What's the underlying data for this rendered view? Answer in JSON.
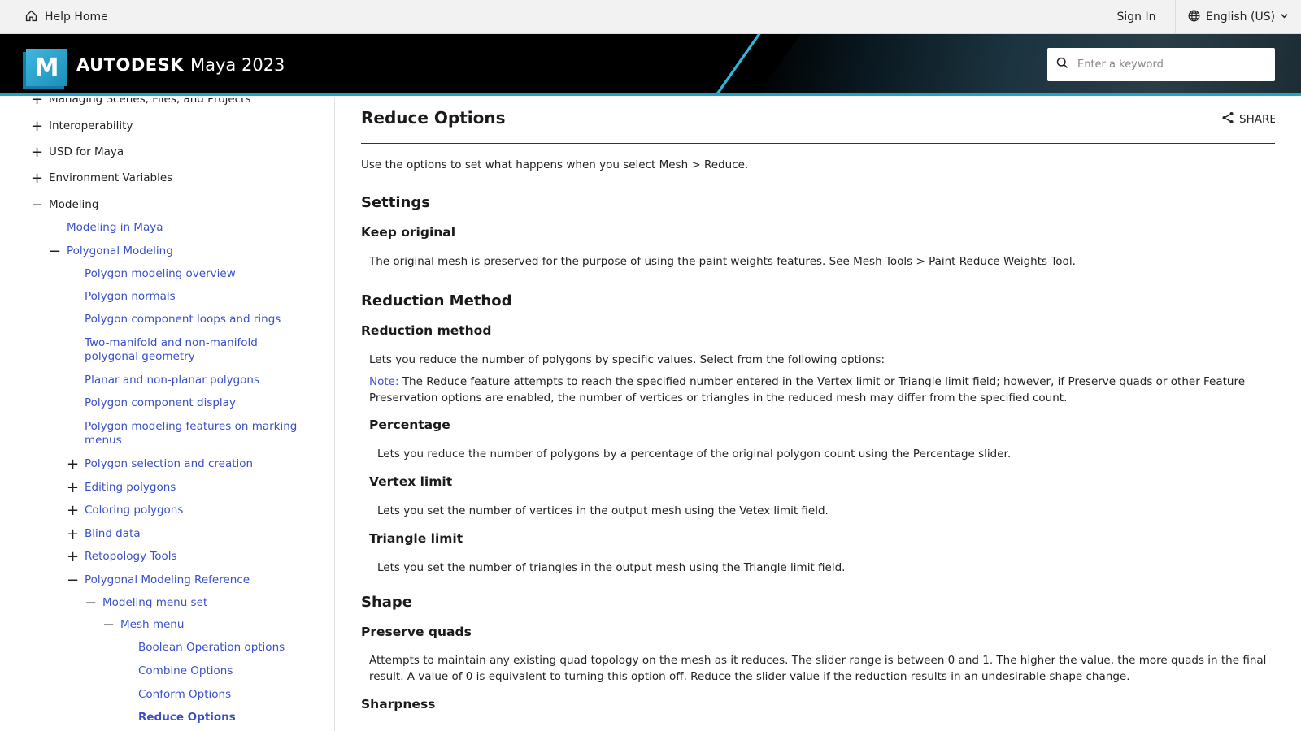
{
  "topbar": {
    "help_home": "Help Home",
    "sign_in": "Sign In",
    "language": "English (US)"
  },
  "brand": {
    "logo_letter": "M",
    "company": "AUTODESK",
    "product": "Maya 2023"
  },
  "search": {
    "placeholder": "Enter a keyword"
  },
  "sidebar": {
    "items": [
      {
        "label": "Managing Scenes, Files, and Projects",
        "toggle": "+"
      },
      {
        "label": "Interoperability",
        "toggle": "+"
      },
      {
        "label": "USD for Maya",
        "toggle": "+"
      },
      {
        "label": "Environment Variables",
        "toggle": "+"
      },
      {
        "label": "Modeling",
        "toggle": "−"
      },
      {
        "label": "Modeling in Maya",
        "toggle": ""
      },
      {
        "label": "Polygonal Modeling",
        "toggle": "−"
      },
      {
        "label": "Polygon modeling overview",
        "toggle": ""
      },
      {
        "label": "Polygon normals",
        "toggle": ""
      },
      {
        "label": "Polygon component loops and rings",
        "toggle": ""
      },
      {
        "label": "Two-manifold and non-manifold polygonal geometry",
        "toggle": ""
      },
      {
        "label": "Planar and non-planar polygons",
        "toggle": ""
      },
      {
        "label": "Polygon component display",
        "toggle": ""
      },
      {
        "label": "Polygon modeling features on marking menus",
        "toggle": ""
      },
      {
        "label": "Polygon selection and creation",
        "toggle": "+"
      },
      {
        "label": "Editing polygons",
        "toggle": "+"
      },
      {
        "label": "Coloring polygons",
        "toggle": "+"
      },
      {
        "label": "Blind data",
        "toggle": "+"
      },
      {
        "label": "Retopology Tools",
        "toggle": "+"
      },
      {
        "label": "Polygonal Modeling Reference",
        "toggle": "−"
      },
      {
        "label": "Modeling menu set",
        "toggle": "−"
      },
      {
        "label": "Mesh menu",
        "toggle": "−"
      },
      {
        "label": "Boolean Operation options",
        "toggle": ""
      },
      {
        "label": "Combine Options",
        "toggle": ""
      },
      {
        "label": "Conform Options",
        "toggle": ""
      },
      {
        "label": "Reduce Options",
        "toggle": ""
      }
    ]
  },
  "content": {
    "title": "Reduce Options",
    "share_label": "SHARE",
    "intro": "Use the options to set what happens when you select Mesh > Reduce.",
    "settings_heading": "Settings",
    "keep_original_heading": "Keep original",
    "keep_original_text": "The original mesh is preserved for the purpose of using the paint weights features. See Mesh Tools > Paint Reduce Weights Tool.",
    "reduction_method_heading": "Reduction Method",
    "reduction_method_sub": "Reduction method",
    "reduction_method_text": "Lets you reduce the number of polygons by specific values. Select from the following options:",
    "note_label": "Note:",
    "note_text": "The Reduce feature attempts to reach the specified number entered in the Vertex limit or Triangle limit field; however, if Preserve quads or other Feature Preservation options are enabled, the number of vertices or triangles in the reduced mesh may differ from the specified count.",
    "percentage_heading": "Percentage",
    "percentage_text": "Lets you reduce the number of polygons by a percentage of the original polygon count using the Percentage slider.",
    "vertex_limit_heading": "Vertex limit",
    "vertex_limit_text": "Lets you set the number of vertices in the output mesh using the Vetex limit field.",
    "triangle_limit_heading": "Triangle limit",
    "triangle_limit_text": "Lets you set the number of triangles in the output mesh using the Triangle limit field.",
    "shape_heading": "Shape",
    "preserve_quads_heading": "Preserve quads",
    "preserve_quads_text": "Attempts to maintain any existing quad topology on the mesh as it reduces. The slider range is between 0 and 1. The higher the value, the more quads in the final result. A value of 0 is equivalent to turning this option off. Reduce the slider value if the reduction results in an undesirable shape change.",
    "sharpness_heading": "Sharpness"
  }
}
